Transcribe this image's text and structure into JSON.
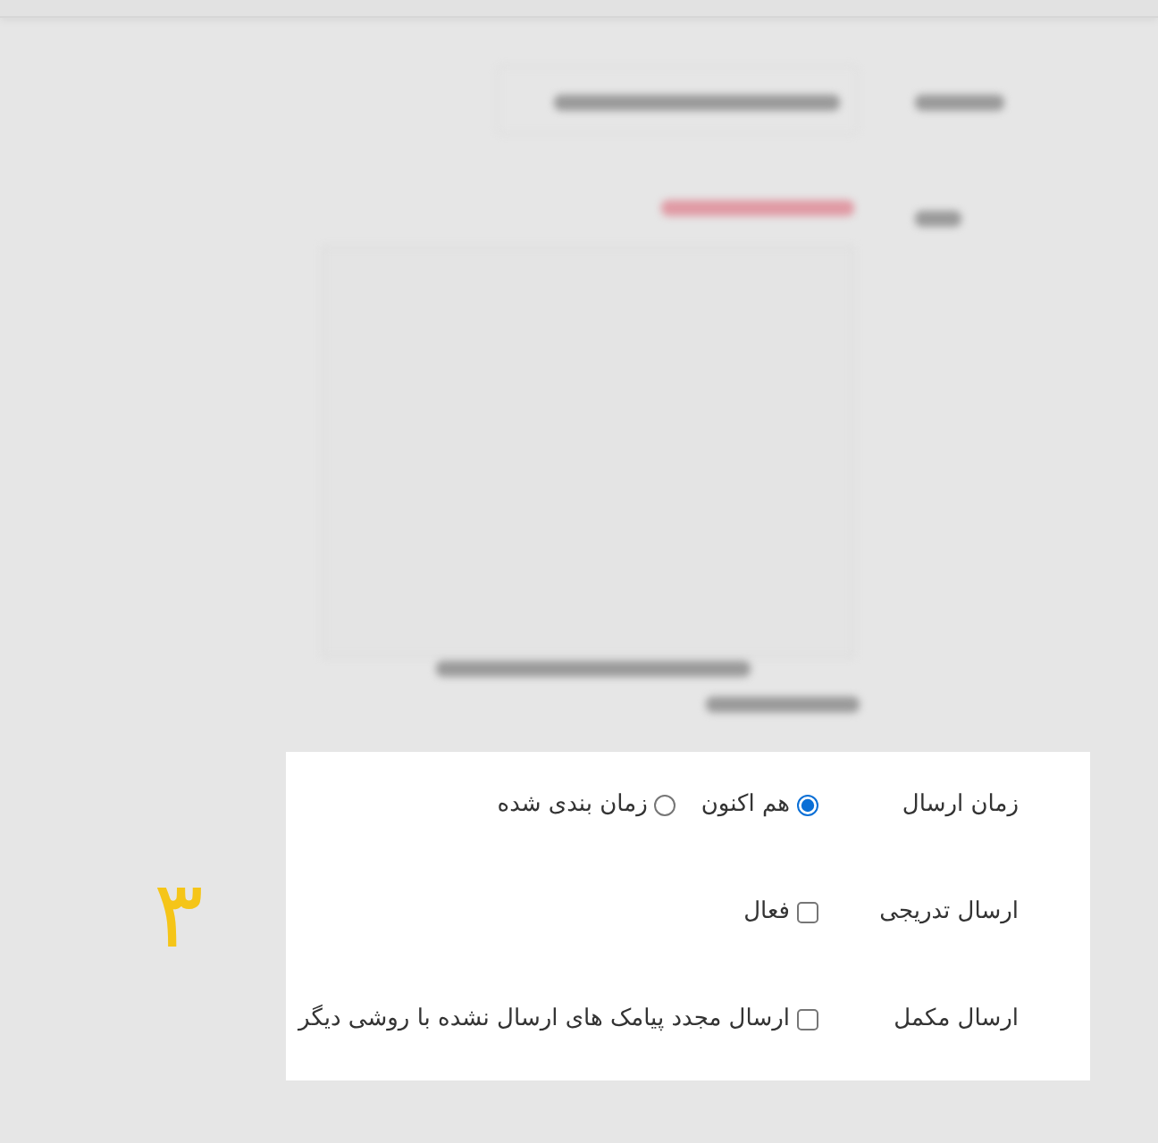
{
  "step_number": "٣",
  "settings": [
    {
      "kind": "radio",
      "label": "زمان ارسال",
      "options": [
        {
          "label": "هم اکنون",
          "selected": true
        },
        {
          "label": "زمان بندی شده",
          "selected": false
        }
      ]
    },
    {
      "kind": "checkbox",
      "label": "ارسال تدریجی",
      "options": [
        {
          "label": "فعال",
          "checked": false
        }
      ]
    },
    {
      "kind": "checkbox",
      "label": "ارسال مکمل",
      "options": [
        {
          "label": "ارسال مجدد پیامک های ارسال نشده با روشی دیگر",
          "checked": false
        }
      ]
    }
  ]
}
